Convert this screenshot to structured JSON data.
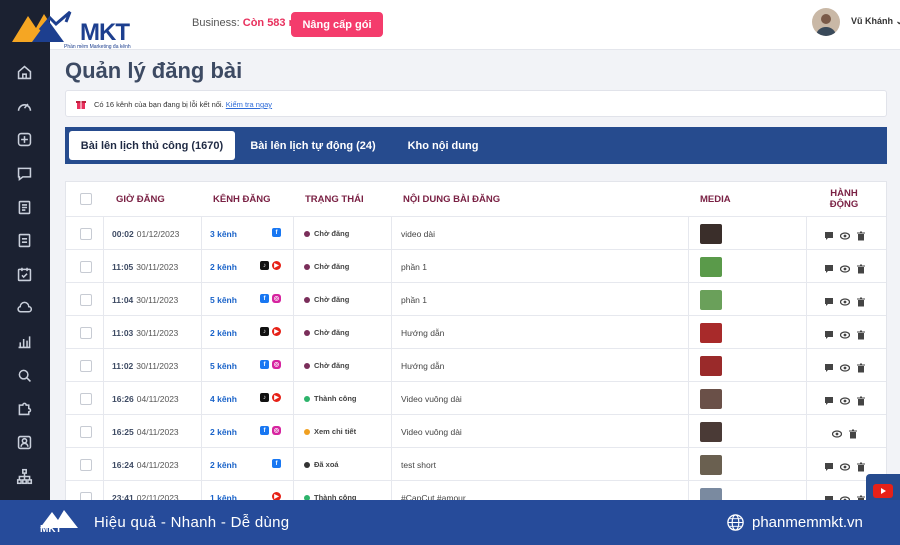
{
  "header": {
    "logo_text": "MKT",
    "logo_subtitle": "Phần mềm Marketing đa kênh",
    "business_label": "Business: ",
    "business_days": "Còn 583 ngày",
    "upgrade_label": "Nâng cấp gói",
    "user_name": "Vũ Khánh"
  },
  "page": {
    "title": "Quản lý đăng bài"
  },
  "alert": {
    "text": "Có 16 kênh của bạn đang bị lỗi kết nối.",
    "link": "Kiểm tra ngay"
  },
  "tabs": [
    {
      "label": "Bài lên lịch thủ công (1670)",
      "active": true
    },
    {
      "label": "Bài lên lịch tự động (24)",
      "active": false
    },
    {
      "label": "Kho nội dung",
      "active": false
    }
  ],
  "table": {
    "headers": {
      "time": "GIỜ ĐĂNG",
      "channel": "KÊNH ĐĂNG",
      "status": "TRẠNG THÁI",
      "content": "NỘI DUNG BÀI ĐĂNG",
      "media": "MEDIA",
      "actions": "HÀNH ĐỘNG"
    },
    "rows": [
      {
        "time": "00:02",
        "date": "01/12/2023",
        "channels": "3 kênh",
        "icons": [
          "fb"
        ],
        "status": "Chờ đăng",
        "status_color": "#7a2e5a",
        "content": "video dài",
        "thumb": "#3a2e2a",
        "actions": [
          "comment",
          "view",
          "delete"
        ]
      },
      {
        "time": "11:05",
        "date": "30/11/2023",
        "channels": "2 kênh",
        "icons": [
          "tt",
          "yt"
        ],
        "status": "Chờ đăng",
        "status_color": "#7a2e5a",
        "content": "phần 1",
        "thumb": "#5a9a4a",
        "actions": [
          "comment",
          "view",
          "delete"
        ]
      },
      {
        "time": "11:04",
        "date": "30/11/2023",
        "channels": "5 kênh",
        "icons": [
          "fb",
          "ig"
        ],
        "status": "Chờ đăng",
        "status_color": "#7a2e5a",
        "content": "phần 1",
        "thumb": "#6aa05a",
        "actions": [
          "comment",
          "view",
          "delete"
        ]
      },
      {
        "time": "11:03",
        "date": "30/11/2023",
        "channels": "2 kênh",
        "icons": [
          "tt",
          "yt"
        ],
        "status": "Chờ đăng",
        "status_color": "#7a2e5a",
        "content": "Hướng dẫn",
        "thumb": "#a82a2a",
        "actions": [
          "comment",
          "view",
          "delete"
        ]
      },
      {
        "time": "11:02",
        "date": "30/11/2023",
        "channels": "5 kênh",
        "icons": [
          "fb",
          "ig"
        ],
        "status": "Chờ đăng",
        "status_color": "#7a2e5a",
        "content": "Hướng dẫn",
        "thumb": "#9a2a2a",
        "actions": [
          "comment",
          "view",
          "delete"
        ]
      },
      {
        "time": "16:26",
        "date": "04/11/2023",
        "channels": "4 kênh",
        "icons": [
          "tt",
          "yt"
        ],
        "status": "Thành công",
        "status_color": "#2db36b",
        "content": "Video vuông dài",
        "thumb": "#6a5048",
        "actions": [
          "comment",
          "view",
          "delete"
        ]
      },
      {
        "time": "16:25",
        "date": "04/11/2023",
        "channels": "2 kênh",
        "icons": [
          "fb",
          "ig"
        ],
        "status": "Xem chi tiết",
        "status_color": "#f0a020",
        "content": "Video vuông dài",
        "thumb": "#4a3a36",
        "actions": [
          "view",
          "delete"
        ]
      },
      {
        "time": "16:24",
        "date": "04/11/2023",
        "channels": "2 kênh",
        "icons": [
          "fb"
        ],
        "status": "Đã xoá",
        "status_color": "#333333",
        "content": "test short",
        "thumb": "#6a6050",
        "actions": [
          "comment",
          "view",
          "delete"
        ]
      },
      {
        "time": "23:41",
        "date": "02/11/2023",
        "channels": "1 kênh",
        "icons": [
          "yt"
        ],
        "status": "Thành công",
        "status_color": "#2db36b",
        "content": "#CapCut #amour",
        "thumb": "#7a8aa0",
        "actions": [
          "comment",
          "view",
          "delete"
        ]
      }
    ]
  },
  "banner": {
    "slogan": "Hiệu quả - Nhanh - Dễ dùng",
    "site": "phanmemmkt.vn",
    "logo_text": "MKT"
  },
  "colors": {
    "sidebar": "#1b2131",
    "tab_bar": "#264b8e",
    "accent_pink": "#f43c6c",
    "banner": "#264b9a"
  }
}
